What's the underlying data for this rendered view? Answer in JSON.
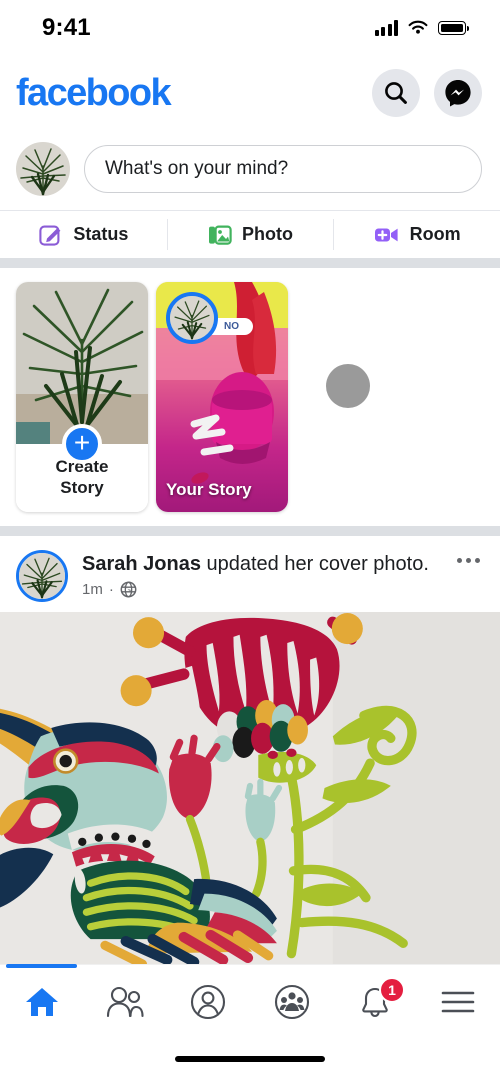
{
  "status_bar": {
    "time": "9:41",
    "signal_icon": "cellular-signal-icon",
    "wifi_icon": "wifi-icon",
    "battery_icon": "battery-icon"
  },
  "header": {
    "logo_text": "facebook",
    "logo_color": "#1877F2",
    "search_icon": "search-icon",
    "messenger_icon": "messenger-icon"
  },
  "composer": {
    "avatar_icon": "user-avatar-plant",
    "placeholder": "What's on your mind?",
    "actions": [
      {
        "label": "Status",
        "icon": "status-pencil-icon",
        "color": "#8B5CD6"
      },
      {
        "label": "Photo",
        "icon": "photo-icon",
        "color": "#41B35D"
      },
      {
        "label": "Room",
        "icon": "room-video-icon",
        "color": "#9360F7"
      }
    ]
  },
  "stories": {
    "create": {
      "label_line1": "Create",
      "label_line2": "Story",
      "plus_icon": "plus-icon",
      "plus_color": "#1877F2"
    },
    "your_story": {
      "label": "Your Story",
      "overlay_text": "NO",
      "ring_color": "#1877F2"
    },
    "placeholder_dot_color": "#9a9a9a"
  },
  "post": {
    "author": "Sarah Jonas",
    "action_text": " updated her cover photo.",
    "timestamp": "1m",
    "separator": "·",
    "audience_icon": "globe-public-icon",
    "menu_icon": "more-options-icon",
    "cover_image": "folk-art-bird-flower-illustration"
  },
  "bottom_nav": {
    "items": [
      {
        "name": "home",
        "icon": "home-icon",
        "active": true
      },
      {
        "name": "friends",
        "icon": "friends-icon",
        "active": false
      },
      {
        "name": "profile",
        "icon": "profile-icon",
        "active": false
      },
      {
        "name": "groups",
        "icon": "groups-icon",
        "active": false
      },
      {
        "name": "notifications",
        "icon": "bell-icon",
        "active": false,
        "badge": "1"
      },
      {
        "name": "menu",
        "icon": "hamburger-menu-icon",
        "active": false
      }
    ],
    "active_color": "#1877F2",
    "badge_color": "#E41E3F"
  },
  "home_indicator": "home-indicator-bar"
}
